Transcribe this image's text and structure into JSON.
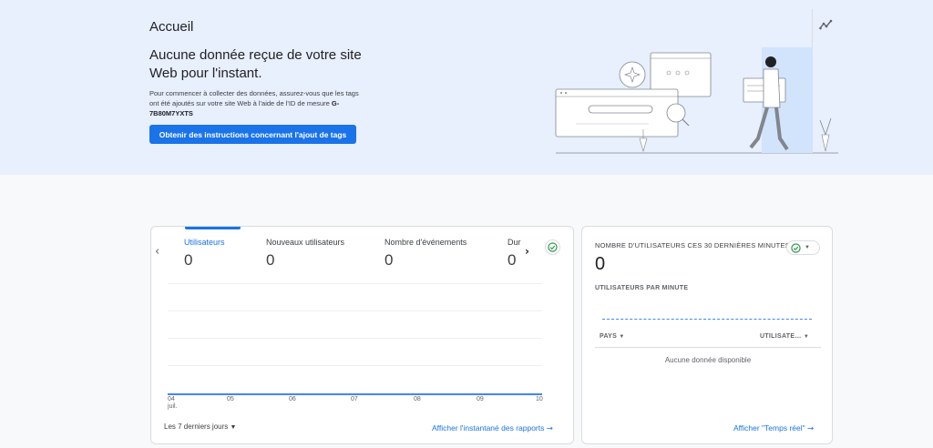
{
  "page": {
    "title": "Accueil"
  },
  "hero": {
    "heading": "Aucune donnée reçue de votre site Web pour l'instant.",
    "description": "Pour commencer à collecter des données, assurez-vous que les tags ont été ajoutés sur votre site Web à l'aide de l'ID de mesure ",
    "measurement_id": "G-7B80M7YXTS",
    "cta_label": "Obtenir des instructions concernant l'ajout de tags"
  },
  "overview_card": {
    "metrics": [
      {
        "label": "Utilisateurs",
        "value": "0",
        "active": true
      },
      {
        "label": "Nouveaux utilisateurs",
        "value": "0"
      },
      {
        "label": "Nombre d'événements",
        "value": "0"
      },
      {
        "label": "Dur",
        "value": "0"
      }
    ],
    "x_ticks": [
      "04",
      "05",
      "06",
      "07",
      "08",
      "09",
      "10"
    ],
    "x_tick_sub": "juil.",
    "date_range": "Les 7 derniers jours",
    "link_label": "Afficher l'instantané des rapports"
  },
  "realtime_card": {
    "title": "NOMBRE D'UTILISATEURS CES 30 DERNIÈRES MINUTES",
    "value": "0",
    "subtitle": "UTILISATEURS PAR MINUTE",
    "columns": [
      "PAYS",
      "UTILISATE…"
    ],
    "empty_text": "Aucune donnée disponible",
    "link_label": "Afficher \"Temps réel\""
  },
  "colors": {
    "accent": "#1a73e8",
    "hero_bg": "#e8effd",
    "success": "#1e8e3e"
  },
  "icons": [
    "insights-icon",
    "chevron-left-icon",
    "chevron-right-icon",
    "check-circle-icon",
    "arrow-right-icon",
    "dropdown-icon"
  ]
}
